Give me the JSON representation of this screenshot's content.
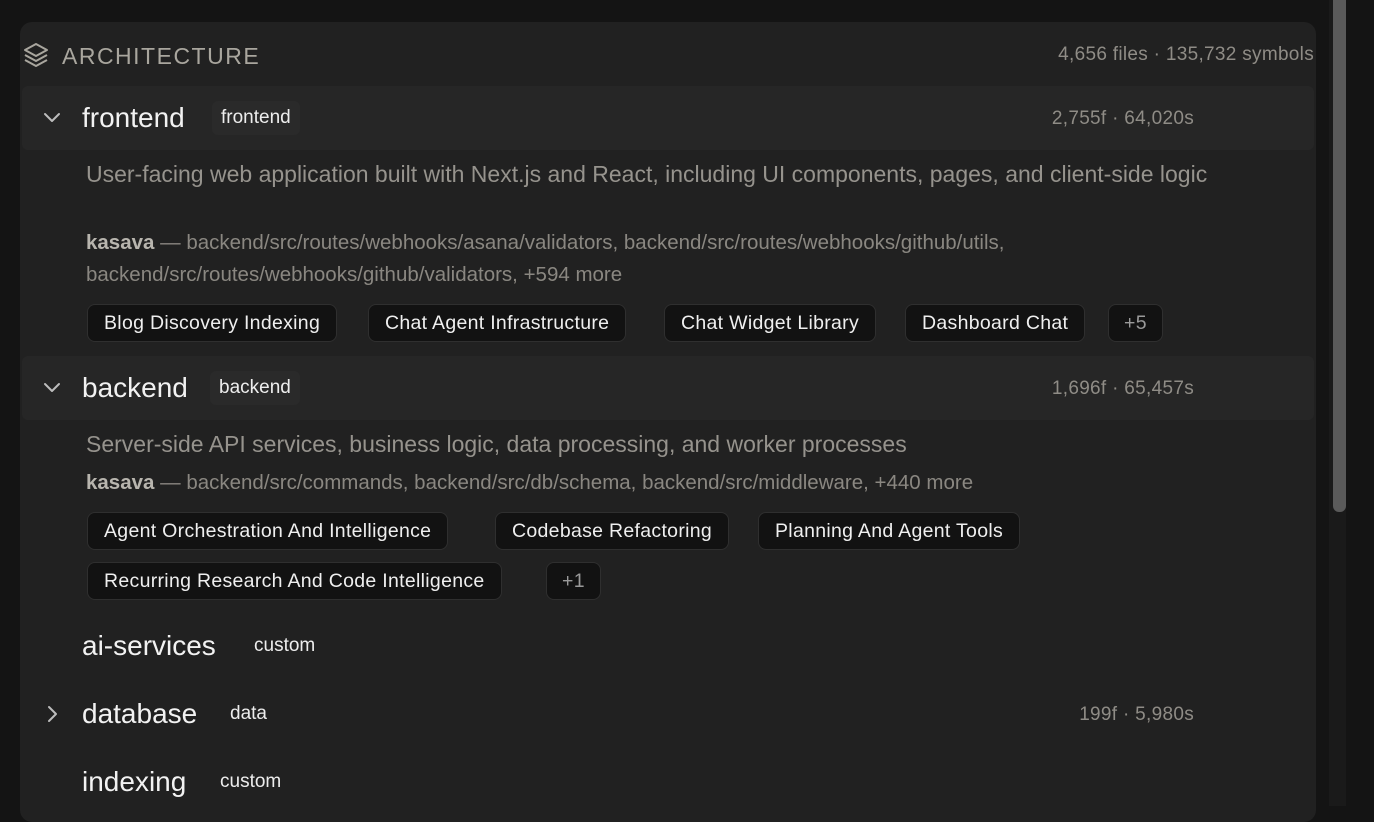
{
  "header": {
    "title": "ARCHITECTURE",
    "totals": "4,656 files · 135,732 symbols",
    "icon": "layers-icon"
  },
  "modules": [
    {
      "name": "frontend",
      "tag": "frontend",
      "stats": "2,755f · 64,020s",
      "description": "User-facing web application built with Next.js and React, including UI components, pages, and client-side logic",
      "owner": "kasava",
      "paths": " — backend/src/routes/webhooks/asana/validators, backend/src/routes/webhooks/github/utils, backend/src/routes/webhooks/github/validators, +594 more",
      "chips": [
        "Blog Discovery Indexing",
        "Chat Agent Infrastructure",
        "Chat Widget Library",
        "Dashboard Chat"
      ],
      "more": "+5"
    },
    {
      "name": "backend",
      "tag": "backend",
      "stats": "1,696f · 65,457s",
      "description": "Server-side API services, business logic, data processing, and worker processes",
      "owner": "kasava",
      "paths": " — backend/src/commands, backend/src/db/schema, backend/src/middleware, +440 more",
      "chips": [
        "Agent Orchestration And Intelligence",
        "Codebase Refactoring",
        "Planning And Agent Tools",
        "Recurring Research And Code Intelligence"
      ],
      "more": "+1"
    },
    {
      "name": "ai-services",
      "tag": "custom"
    },
    {
      "name": "database",
      "tag": "data",
      "stats": "199f · 5,980s"
    },
    {
      "name": "indexing",
      "tag": "custom"
    }
  ],
  "colors": {
    "background": "#141414",
    "panel": "#212121",
    "chip_bg": "#121212"
  }
}
